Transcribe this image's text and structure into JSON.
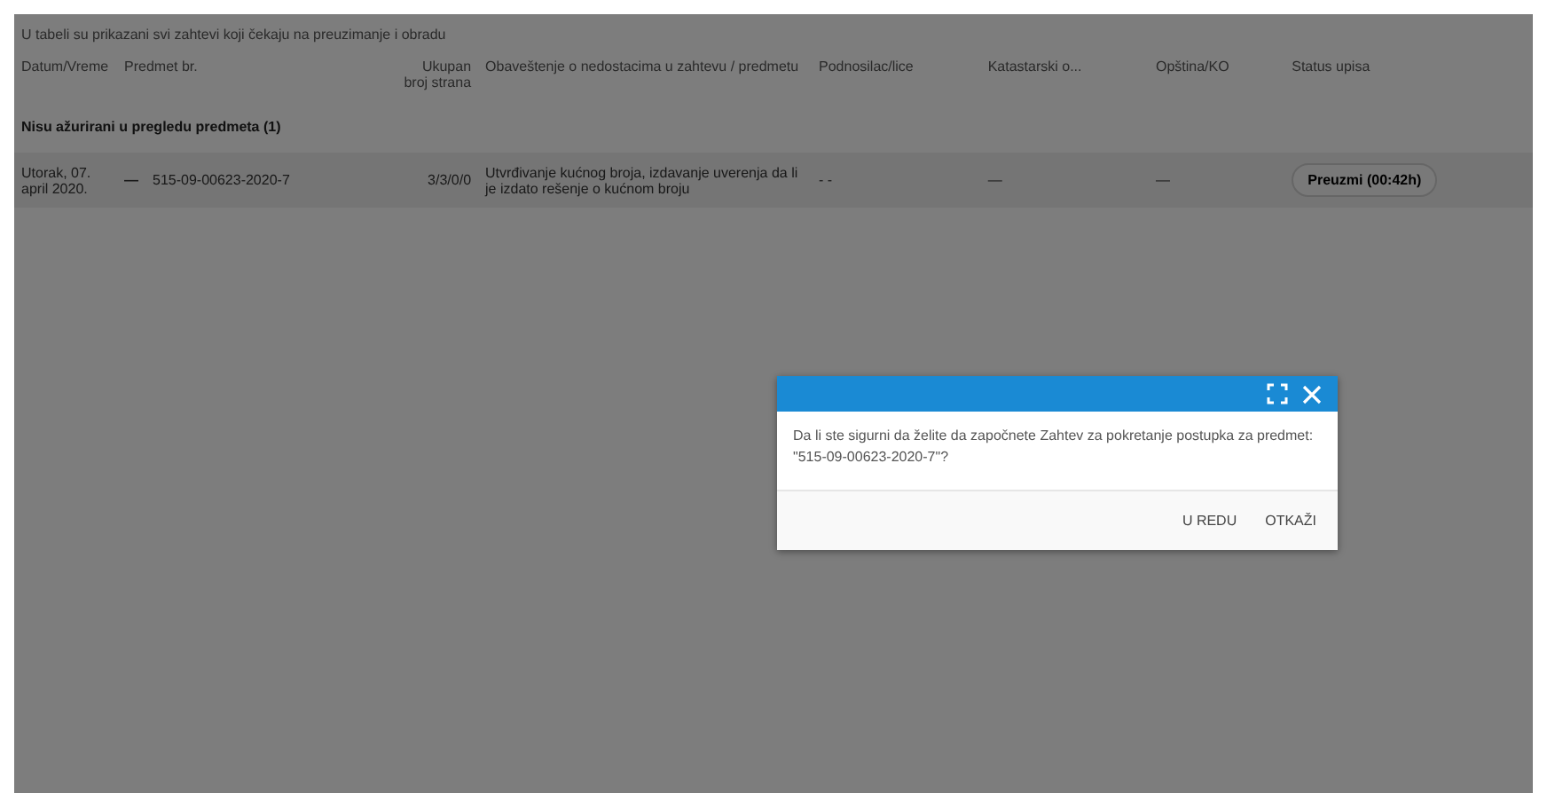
{
  "intro": "U tabeli su prikazani svi zahtevi koji čekaju na preuzimanje i obradu",
  "table": {
    "columns": [
      "Datum/Vreme",
      "Predmet br.",
      "Ukupan broj strana",
      "Obaveštenje o nedostacima u zahtevu / predmetu",
      "Podnosilac/lice",
      "Katastarski o...",
      "Opština/KO",
      "Status upisa"
    ],
    "groups": [
      {
        "title": "Nisu ažurirani u pregledu predmeta (1)",
        "rows": [
          {
            "date": "Utorak, 07. april 2020.",
            "flag": "—",
            "number": "515-09-00623-2020-7",
            "pages": "3/3/0/0",
            "note": "Utvrđivanje kućnog broja, izdavanje uverenja da li je izdato rešenje o kućnom broju",
            "applicant": "- -",
            "col6": "—",
            "col7": "—",
            "action": "Preuzmi (00:42h)"
          }
        ]
      }
    ]
  },
  "dialog": {
    "message": "Da li ste sigurni da želite da započnete Zahtev za pokretanje postupka za predmet: \"515-09-00623-2020-7\"?",
    "buttons": [
      "U REDU",
      "OTKAŽI"
    ]
  }
}
